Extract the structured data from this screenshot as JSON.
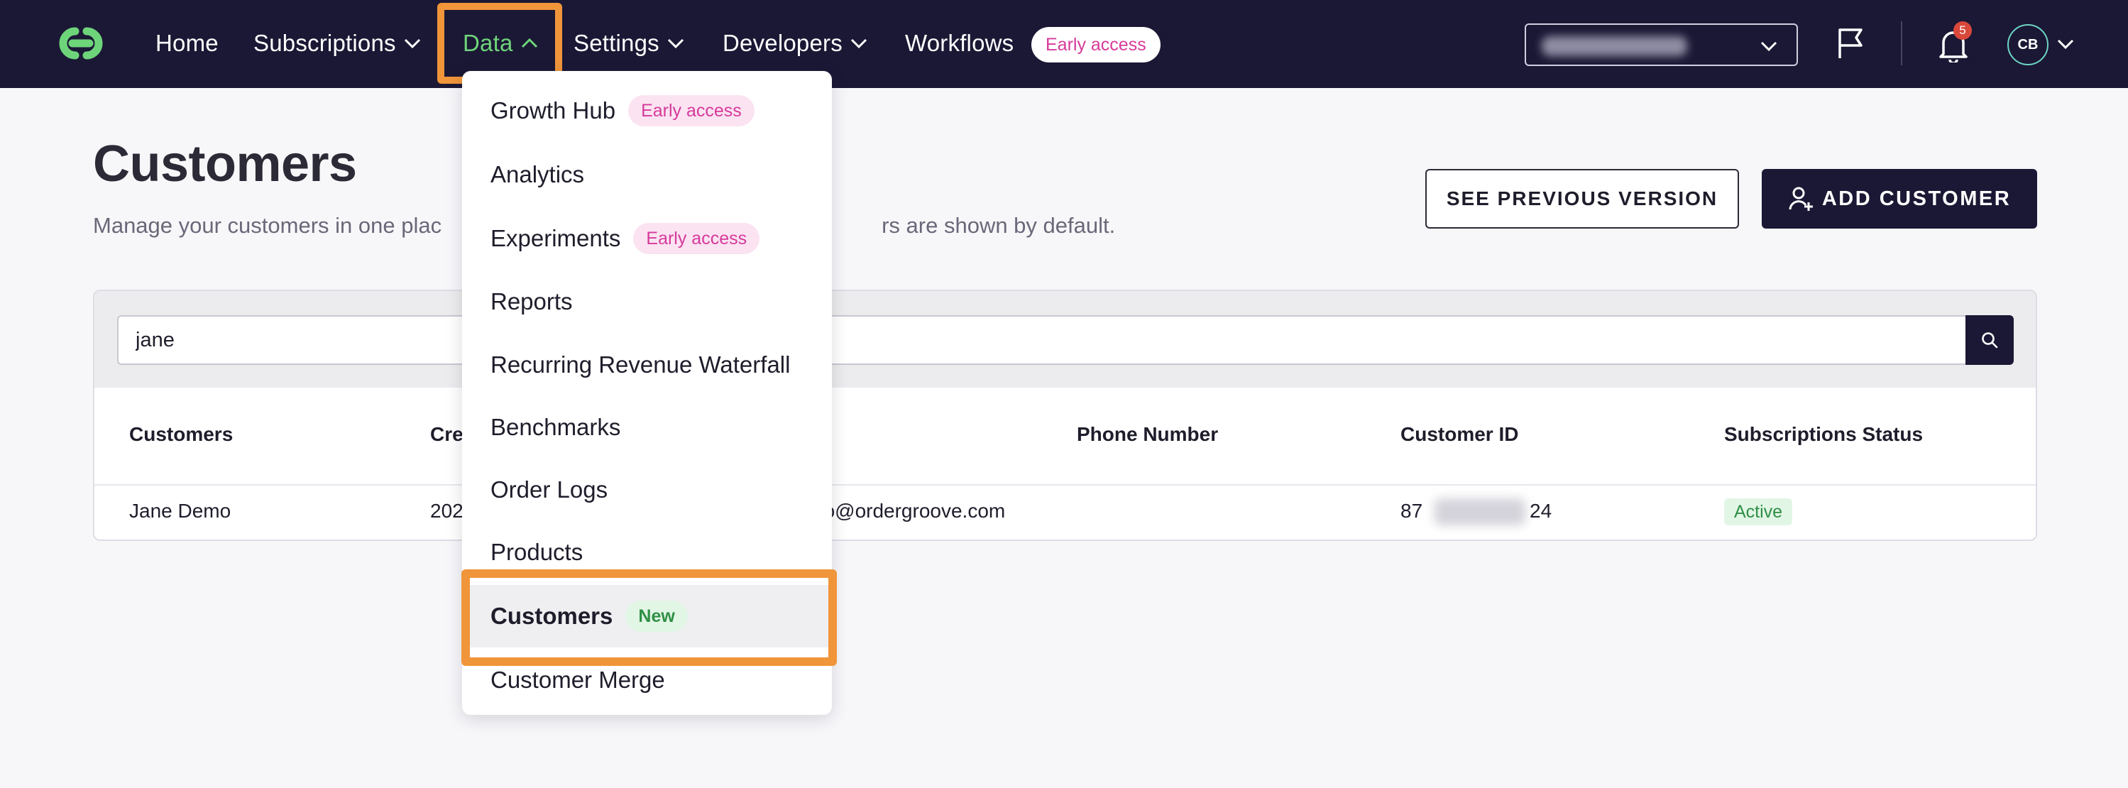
{
  "nav": {
    "items": [
      {
        "label": "Home",
        "has_chevron": false
      },
      {
        "label": "Subscriptions",
        "has_chevron": true
      },
      {
        "label": "Data",
        "has_chevron": true,
        "active": true
      },
      {
        "label": "Settings",
        "has_chevron": true
      },
      {
        "label": "Developers",
        "has_chevron": true
      },
      {
        "label": "Workflows",
        "has_chevron": false
      }
    ],
    "workflows_badge": "Early access",
    "notification_count": "5",
    "avatar_initials": "CB"
  },
  "page": {
    "title": "Customers",
    "subtitle_left": "Manage your customers in one plac",
    "subtitle_right": "rs are shown by default.",
    "see_previous_label": "SEE PREVIOUS VERSION",
    "add_customer_label": "ADD CUSTOMER"
  },
  "search": {
    "value": "jane"
  },
  "table": {
    "columns": [
      "Customers",
      "Cre",
      "Phone Number",
      "Customer ID",
      "Subscriptions Status"
    ],
    "rows": [
      {
        "customer": "Jane Demo",
        "created": "202",
        "email": "no@ordergroove.com",
        "phone": "",
        "id_start": "87",
        "id_end": "24",
        "status": "Active"
      }
    ]
  },
  "dropdown": {
    "items": [
      {
        "label": "Growth Hub",
        "badge": "Early access"
      },
      {
        "label": "Analytics"
      },
      {
        "label": "Experiments",
        "badge": "Early access"
      },
      {
        "label": "Reports"
      },
      {
        "label": "Recurring Revenue Waterfall"
      },
      {
        "label": "Benchmarks"
      },
      {
        "label": "Order Logs"
      },
      {
        "label": "Products"
      },
      {
        "label": "Customers",
        "badge": "New",
        "selected": true
      },
      {
        "label": "Customer Merge"
      }
    ]
  },
  "colors": {
    "navbar": "#1b1835",
    "accent_green": "#6ed47a",
    "highlight_orange": "#f0953a",
    "early_access_pink": "#d63a9a"
  }
}
